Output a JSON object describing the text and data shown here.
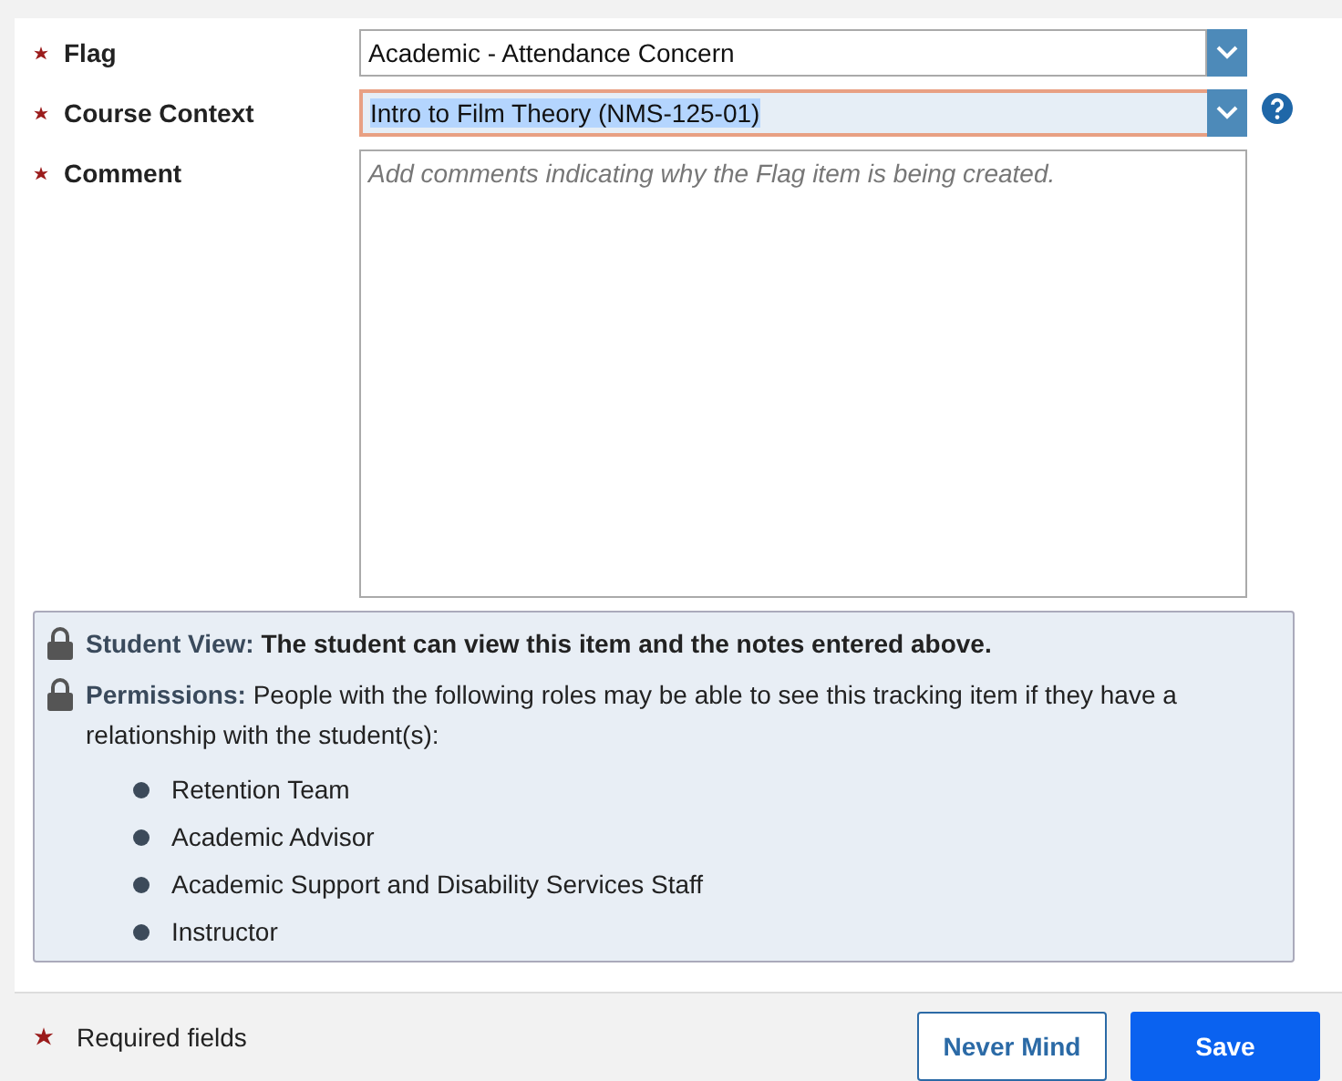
{
  "fields": [
    {
      "label": "Flag",
      "required": true,
      "kind": "select",
      "value": "Academic - Attendance Concern",
      "focused": false,
      "help": false
    },
    {
      "label": "Course Context",
      "required": true,
      "kind": "select",
      "value": "Intro to Film Theory (NMS-125-01)",
      "focused": true,
      "help": true
    },
    {
      "label": "Comment",
      "required": true,
      "kind": "textarea",
      "placeholder": "Add comments indicating why the Flag item is being created.",
      "focused": false,
      "help": false
    }
  ],
  "notes": [
    {
      "label": "Student View:",
      "text": "The student can view this item and the notes entered above.",
      "bold": true
    },
    {
      "label": "Permissions:",
      "text": "People with the following roles may be able to see this tracking item if they have a relationship with the student(s):",
      "bold": false
    }
  ],
  "roles": [
    "Retention Team",
    "Academic Advisor",
    "Academic Support and Disability Services Staff",
    "Instructor"
  ],
  "footer": {
    "required_note": "Required fields",
    "buttons": [
      {
        "label": "Never Mind",
        "kind": "secondary"
      },
      {
        "label": "Save",
        "kind": "primary"
      }
    ]
  }
}
